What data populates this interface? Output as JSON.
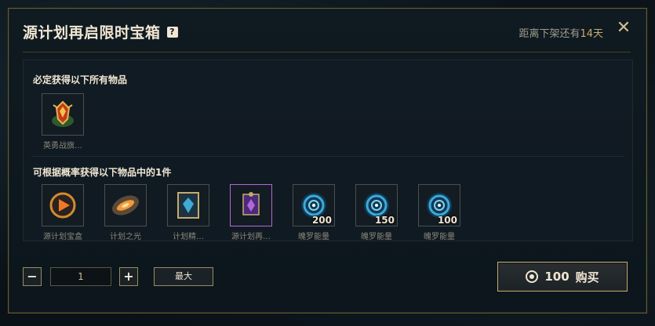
{
  "modal": {
    "title": "源计划再启限时宝箱",
    "help_icon": "?",
    "expire_prefix": "距离下架还有",
    "expire_days": "14天",
    "close_icon": "✕"
  },
  "guaranteed": {
    "section_title": "必定获得以下所有物品",
    "items": [
      {
        "label": "英勇战旗…",
        "icon": "banner-icon"
      }
    ]
  },
  "chance": {
    "section_title": "可根据概率获得以下物品中的1件",
    "items": [
      {
        "label": "源计划宝盒",
        "icon": "chest-icon",
        "qty": ""
      },
      {
        "label": "计划之光",
        "icon": "light-icon",
        "qty": ""
      },
      {
        "label": "计划精…",
        "icon": "emblem-icon",
        "qty": ""
      },
      {
        "label": "源计划再…",
        "icon": "epic-item-icon",
        "qty": ""
      },
      {
        "label": "魄罗能量",
        "icon": "swirl-icon",
        "qty": "200"
      },
      {
        "label": "魄罗能量",
        "icon": "swirl-icon",
        "qty": "150"
      },
      {
        "label": "魄罗能量",
        "icon": "swirl-icon",
        "qty": "100"
      }
    ]
  },
  "controls": {
    "minus": "−",
    "quantity": "1",
    "plus": "+",
    "max_label": "最大",
    "buy_price": "100",
    "buy_label": "购买"
  },
  "colors": {
    "gold": "#c8aa6e",
    "epic_border": "#b368d6",
    "swirl": "#3fa9d8"
  }
}
